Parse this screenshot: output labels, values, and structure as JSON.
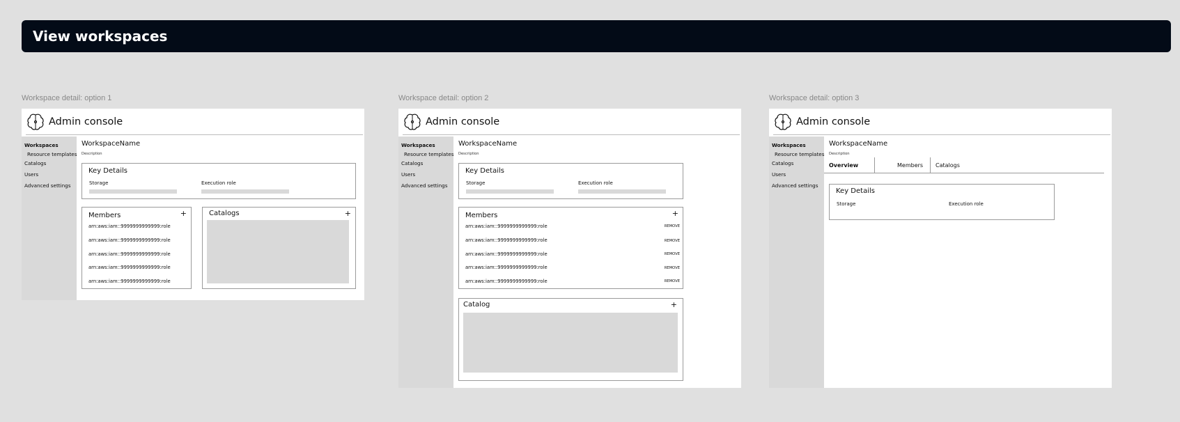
{
  "banner": {
    "title": "View workspaces"
  },
  "app_title": "Admin console",
  "sidebar": {
    "items": [
      "Workspaces",
      "Resource templates",
      "Catalogs",
      "Users",
      "Advanced settings"
    ]
  },
  "workspace": {
    "name": "WorkspaceName",
    "description": "Description"
  },
  "key_details": {
    "title": "Key Details",
    "storage_label": "Storage",
    "execution_role_label": "Execution role"
  },
  "members": {
    "title": "Members",
    "add_label": "+",
    "remove_label": "REMOVE",
    "rows": [
      "arn:aws:iam::9999999999999:role",
      "arn:aws:iam::9999999999999:role",
      "arn:aws:iam::9999999999999:role",
      "arn:aws:iam::9999999999999:role",
      "arn:aws:iam::9999999999999:role"
    ]
  },
  "options": [
    {
      "label": "Workspace detail: option 1",
      "catalog_title": "Catalogs"
    },
    {
      "label": "Workspace detail: option 2",
      "catalog_title": "Catalog"
    },
    {
      "label": "Workspace detail: option 3"
    }
  ],
  "tabs": [
    "Overview",
    "Members",
    "Catalogs"
  ],
  "colors": {
    "banner_bg": "#030b17",
    "page_bg": "#e0e0e0",
    "sidebar_bg": "#d9d9d9",
    "placeholder": "#d9d9d9"
  }
}
